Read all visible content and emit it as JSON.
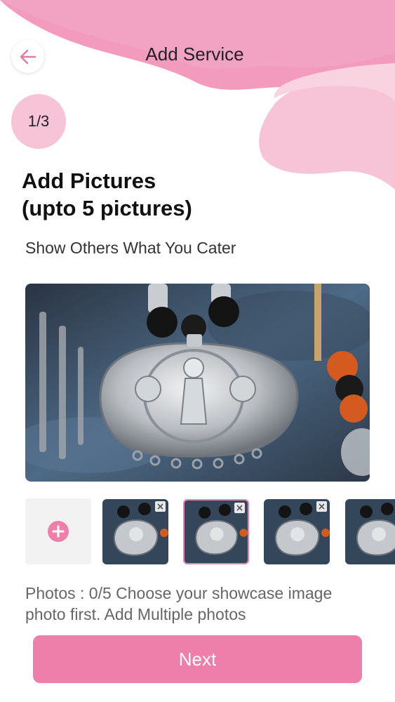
{
  "header": {
    "title": "Add Service",
    "back_icon": "arrow-left-icon"
  },
  "step": {
    "label": "1/3"
  },
  "content": {
    "heading_line1": "Add Pictures",
    "heading_line2": "(upto 5 pictures)",
    "subheading": "Show Others What You Cater"
  },
  "thumbnails": {
    "add_icon": "plus-circle-icon",
    "items": [
      {
        "selected": false,
        "remove_icon": "close-icon"
      },
      {
        "selected": true,
        "remove_icon": "close-icon"
      },
      {
        "selected": false,
        "remove_icon": "close-icon"
      },
      {
        "selected": false,
        "remove_icon": "close-icon"
      }
    ]
  },
  "photos_note": "Photos :  0/5 Choose your showcase image photo first. Add Multiple photos",
  "next_button": {
    "label": "Next"
  },
  "colors": {
    "accent": "#ee7fab",
    "badge": "#f7c3d6",
    "wave": "#f29bbd"
  }
}
